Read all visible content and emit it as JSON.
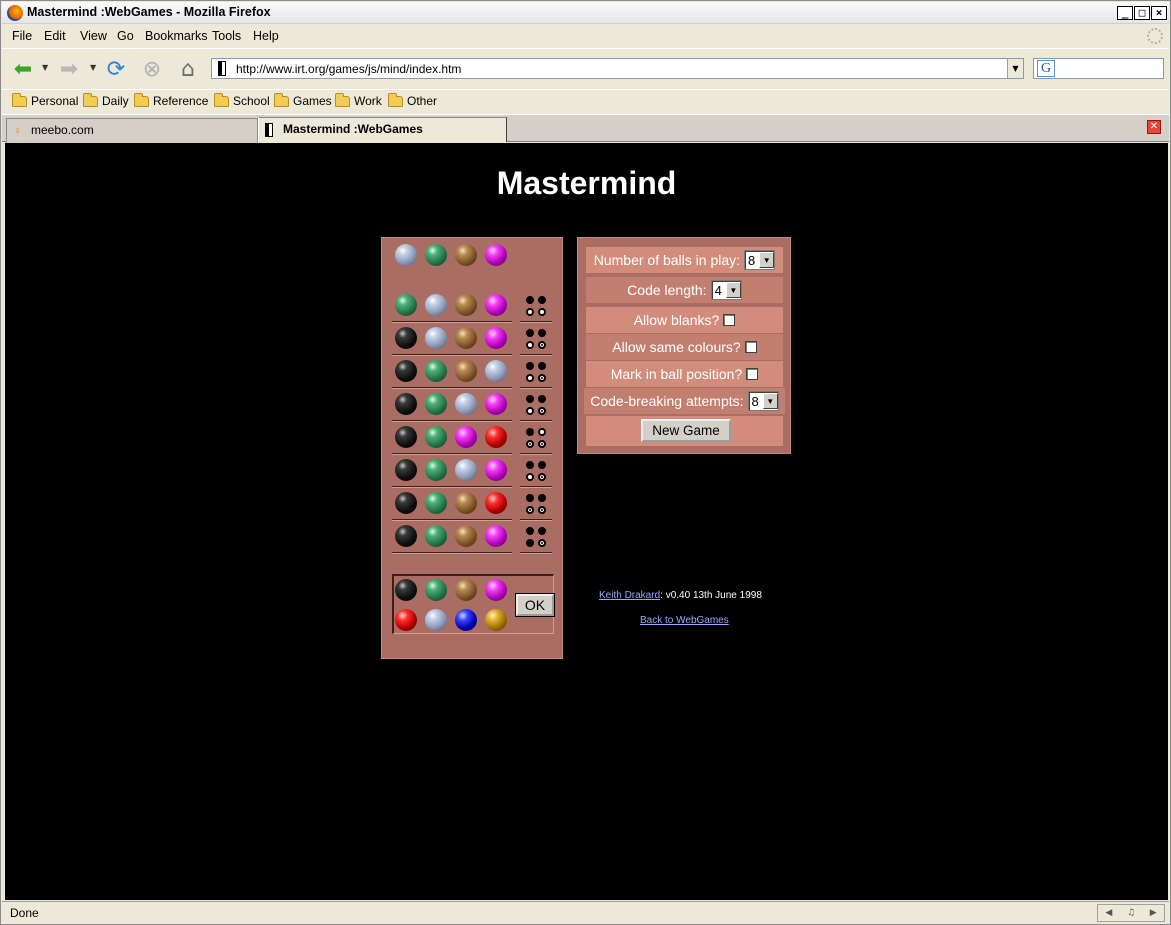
{
  "window": {
    "title": "Mastermind :WebGames - Mozilla Firefox"
  },
  "menu": [
    "File",
    "Edit",
    "View",
    "Go",
    "Bookmarks",
    "Tools",
    "Help"
  ],
  "nav": {
    "url": "http://www.irt.org/games/js/mind/index.htm"
  },
  "bookmarks": [
    "Personal",
    "Daily",
    "Reference",
    "School",
    "Games",
    "Work",
    "Other"
  ],
  "tabs": [
    {
      "label": "meebo.com",
      "active": false
    },
    {
      "label": "Mastermind :WebGames",
      "active": true
    }
  ],
  "page": {
    "title": "Mastermind",
    "secret_row": [
      "silver",
      "green",
      "brown",
      "magenta"
    ],
    "guesses": [
      {
        "balls": [
          "green",
          "silver",
          "brown",
          "magenta"
        ],
        "pegs": [
          "b",
          "b",
          "w",
          "w"
        ]
      },
      {
        "balls": [
          "black",
          "silver",
          "brown",
          "magenta"
        ],
        "pegs": [
          "b",
          "b",
          "w",
          "e"
        ]
      },
      {
        "balls": [
          "black",
          "green",
          "brown",
          "silver"
        ],
        "pegs": [
          "b",
          "b",
          "w",
          "e"
        ]
      },
      {
        "balls": [
          "black",
          "green",
          "silver",
          "magenta"
        ],
        "pegs": [
          "b",
          "b",
          "w",
          "e"
        ]
      },
      {
        "balls": [
          "black",
          "green",
          "magenta",
          "red"
        ],
        "pegs": [
          "b",
          "w",
          "e",
          "e"
        ]
      },
      {
        "balls": [
          "black",
          "green",
          "silver",
          "magenta"
        ],
        "pegs": [
          "b",
          "b",
          "w",
          "e"
        ]
      },
      {
        "balls": [
          "black",
          "green",
          "brown",
          "red"
        ],
        "pegs": [
          "b",
          "b",
          "e",
          "e"
        ]
      },
      {
        "balls": [
          "black",
          "green",
          "brown",
          "magenta"
        ],
        "pegs": [
          "b",
          "b",
          "b",
          "e"
        ]
      }
    ],
    "palette": [
      "black",
      "green",
      "brown",
      "magenta",
      "red",
      "silver",
      "blue",
      "gold"
    ],
    "ok_label": "OK",
    "settings": {
      "balls_in_play_label": "Number of balls in play:",
      "balls_in_play_value": "8",
      "code_length_label": "Code length:",
      "code_length_value": "4",
      "allow_blanks_label": "Allow blanks?",
      "allow_same_label": "Allow same colours?",
      "mark_position_label": "Mark in ball position?",
      "attempts_label": "Code-breaking attempts:",
      "attempts_value": "8",
      "new_game_label": "New Game"
    },
    "credits": {
      "author_link": "Keith Drakard",
      "author_suffix": ": v0.40 13th June 1998",
      "back_link": "Back to WebGames"
    }
  },
  "status": {
    "text": "Done"
  }
}
